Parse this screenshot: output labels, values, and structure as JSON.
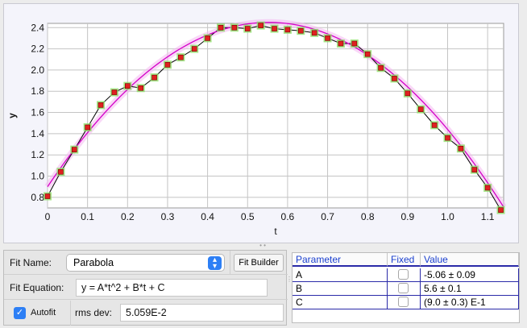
{
  "chart_data": {
    "type": "scatter",
    "xlabel": "t",
    "ylabel": "y",
    "xlim": [
      0,
      1.14
    ],
    "ylim": [
      0.7,
      2.44
    ],
    "x_ticks": [
      "0",
      "0.1",
      "0.2",
      "0.3",
      "0.4",
      "0.5",
      "0.6",
      "0.7",
      "0.8",
      "0.9",
      "1.0",
      "1.1"
    ],
    "x_tick_values": [
      0,
      0.1,
      0.2,
      0.3,
      0.4,
      0.5,
      0.6,
      0.7,
      0.8,
      0.9,
      1.0,
      1.1
    ],
    "y_ticks": [
      "0.8",
      "1.0",
      "1.2",
      "1.4",
      "1.6",
      "1.8",
      "2.0",
      "2.2",
      "2.4"
    ],
    "y_tick_values": [
      0.8,
      1.0,
      1.2,
      1.4,
      1.6,
      1.8,
      2.0,
      2.2,
      2.4
    ],
    "series": [
      {
        "x": [
          0.0,
          0.033,
          0.067,
          0.1,
          0.133,
          0.167,
          0.2,
          0.233,
          0.267,
          0.3,
          0.333,
          0.367,
          0.4,
          0.433,
          0.467,
          0.5,
          0.533,
          0.567,
          0.6,
          0.633,
          0.667,
          0.7,
          0.733,
          0.767,
          0.8,
          0.833,
          0.867,
          0.9,
          0.933,
          0.967,
          1.0,
          1.033,
          1.067,
          1.1,
          1.133
        ],
        "y": [
          0.81,
          1.04,
          1.25,
          1.46,
          1.67,
          1.79,
          1.85,
          1.83,
          1.93,
          2.05,
          2.12,
          2.2,
          2.3,
          2.4,
          2.4,
          2.39,
          2.42,
          2.39,
          2.38,
          2.37,
          2.35,
          2.3,
          2.25,
          2.25,
          2.15,
          2.02,
          1.92,
          1.78,
          1.63,
          1.48,
          1.36,
          1.26,
          1.06,
          0.89,
          0.68
        ]
      }
    ],
    "fit": {
      "A": -5.06,
      "B": 5.6,
      "C": 0.9
    },
    "colors": {
      "point_fill": "#e02020",
      "point_halo": "#8fe06a",
      "data_line": "#000000",
      "fit_line": "#d400c8",
      "fit_band": "#f4b8f0",
      "grid": "#c4c4c4"
    }
  },
  "controls": {
    "fit_name_label": "Fit Name:",
    "fit_name_value": "Parabola",
    "fit_builder_label": "Fit Builder",
    "fit_equation_label": "Fit Equation:",
    "fit_equation_value": "y = A*t^2 + B*t + C",
    "autofit_label": "Autofit",
    "autofit_checked": true,
    "rms_label": "rms dev:",
    "rms_value": "5.059E-2"
  },
  "table": {
    "headers": [
      "Parameter",
      "Fixed",
      "Value"
    ],
    "rows": [
      {
        "param": "A",
        "fixed": false,
        "value": "-5.06 ± 0.09"
      },
      {
        "param": "B",
        "fixed": false,
        "value": "5.6 ± 0.1"
      },
      {
        "param": "C",
        "fixed": false,
        "value": "(9.0 ± 0.3) E-1"
      }
    ]
  }
}
